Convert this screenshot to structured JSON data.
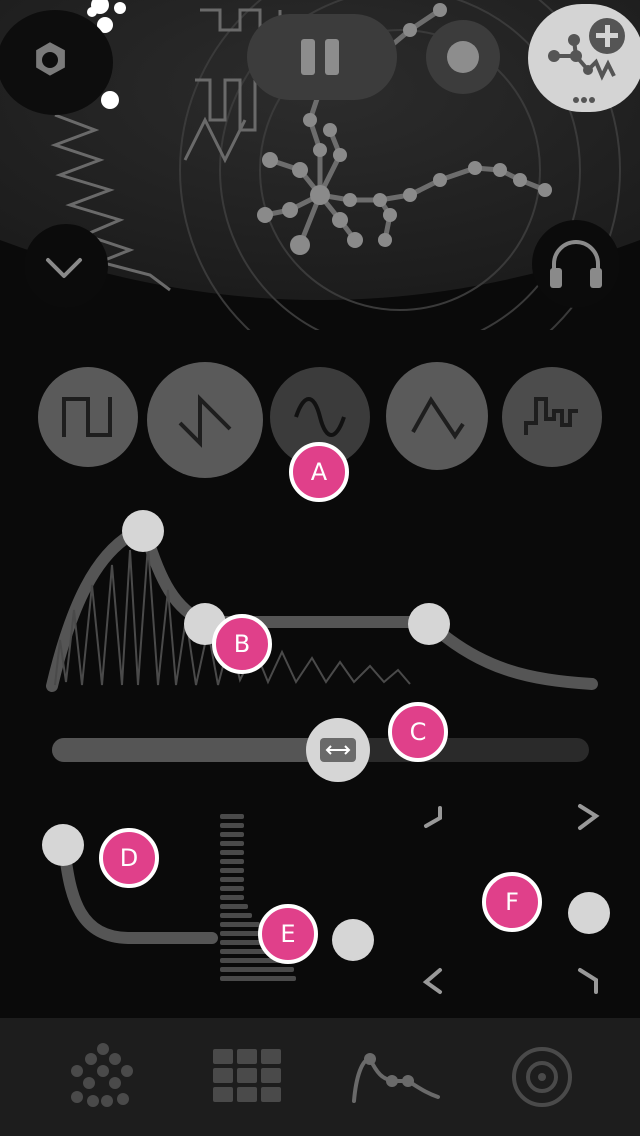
{
  "header": {
    "settings_icon": "hexagon-nut-icon",
    "pause_icon": "pause-icon",
    "record_icon": "record-icon",
    "add_node_icon": "add-node-icon",
    "collapse_icon": "chevron-down-icon",
    "headphones_icon": "headphones-icon"
  },
  "waveforms": [
    {
      "name": "square",
      "icon": "square-wave-icon"
    },
    {
      "name": "sawtooth",
      "icon": "sawtooth-wave-icon"
    },
    {
      "name": "sine",
      "icon": "sine-wave-icon",
      "selected": true
    },
    {
      "name": "triangle",
      "icon": "triangle-wave-icon"
    },
    {
      "name": "random",
      "icon": "random-step-wave-icon"
    }
  ],
  "badges": {
    "a": "A",
    "b": "B",
    "c": "C",
    "d": "D",
    "e": "E",
    "f": "F"
  },
  "slider": {
    "icon": "horizontal-arrows-icon"
  },
  "tabs": [
    {
      "name": "nodes",
      "icon": "dots-cluster-icon"
    },
    {
      "name": "grid",
      "icon": "grid-icon"
    },
    {
      "name": "envelope",
      "icon": "envelope-curve-icon",
      "active": true
    },
    {
      "name": "target",
      "icon": "target-icon"
    }
  ],
  "colors": {
    "accent": "#e0408a",
    "background": "#0a0a0a",
    "button": "#5a5a5a",
    "knob": "#d6d6d6"
  }
}
